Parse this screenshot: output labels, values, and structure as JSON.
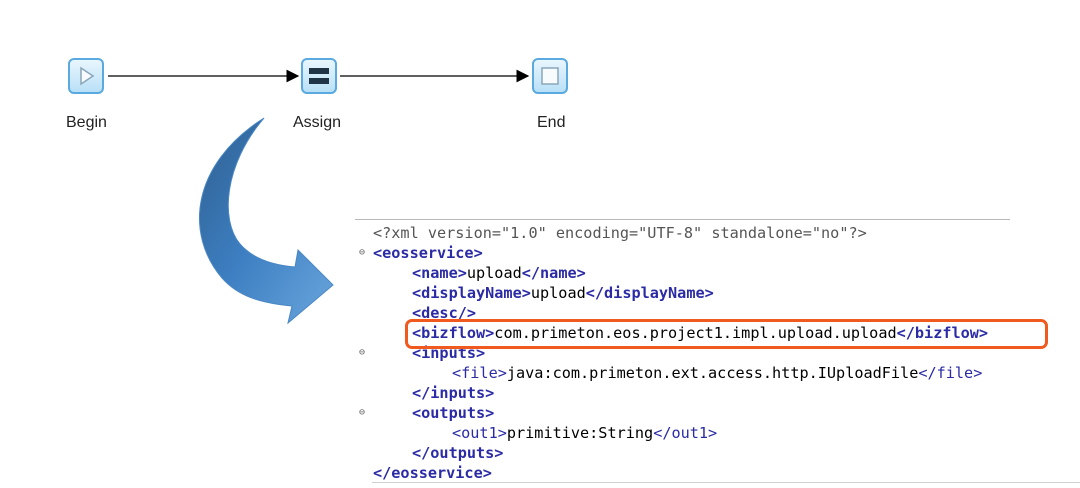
{
  "flow": {
    "nodes": [
      {
        "id": "begin",
        "label": "Begin",
        "shape": "play-triangle"
      },
      {
        "id": "assign",
        "label": "Assign",
        "shape": "two-bars"
      },
      {
        "id": "end",
        "label": "End",
        "shape": "square"
      }
    ],
    "edges": [
      {
        "from": "begin",
        "to": "assign"
      },
      {
        "from": "assign",
        "to": "end"
      }
    ]
  },
  "colors": {
    "node_border": "#5aa9df",
    "big_arrow": "#3d7fc2",
    "highlight": "#f05a1f",
    "xml_tag": "#2b2ba6"
  },
  "xml": {
    "declaration": "<?xml version=\"1.0\" encoding=\"UTF-8\" standalone=\"no\"?>",
    "eosservice_open": "<eosservice>",
    "name_open": "<name>",
    "name_value": "upload",
    "name_close": "</name>",
    "displayName_open": "<displayName>",
    "displayName_value": "upload",
    "displayName_close": "</displayName>",
    "desc": "<desc/>",
    "bizflow_open": "<bizflow>",
    "bizflow_value": "com.primeton.eos.project1.impl.upload.upload",
    "bizflow_close": "</bizflow>",
    "inputs_open": "<inputs>",
    "file_open": "<file>",
    "file_value": "java:com.primeton.ext.access.http.IUploadFile",
    "file_close": "</file>",
    "inputs_close": "</inputs>",
    "outputs_open": "<outputs>",
    "out1_open": "<out1>",
    "out1_value": "primitive:String",
    "out1_close": "</out1>",
    "outputs_close": "</outputs>",
    "eosservice_close": "</eosservice>",
    "fold_marker": "⊖"
  }
}
